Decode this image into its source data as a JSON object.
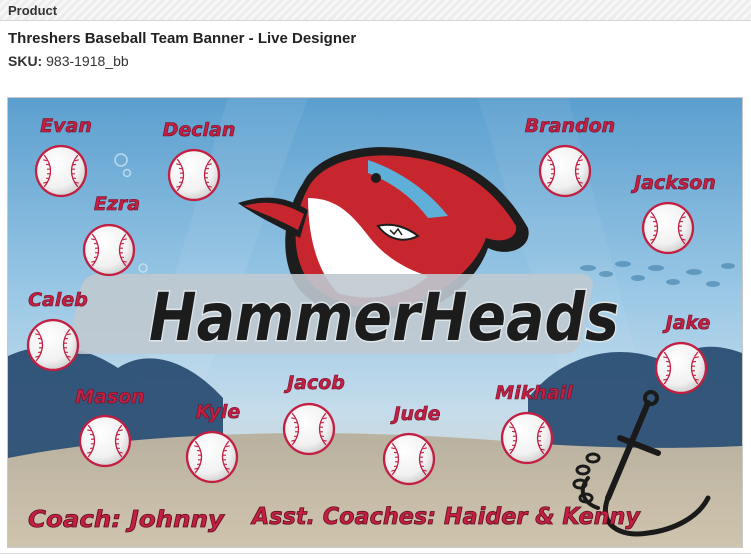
{
  "panel": {
    "header": "Product"
  },
  "product": {
    "title": "Threshers Baseball Team Banner - Live Designer",
    "sku_label": "SKU:",
    "sku_value": "983-1918_bb"
  },
  "banner": {
    "team_name": "HammerHeads",
    "players": [
      "Evan",
      "Declan",
      "Ezra",
      "Caleb",
      "Mason",
      "Kyle",
      "Jacob",
      "Jude",
      "Mikhail",
      "Brandon",
      "Jackson",
      "Jake"
    ],
    "coach_text": "Coach: Johnny",
    "asst_coaches_text": "Asst. Coaches: Haider & Kenny",
    "colors": {
      "name_red": "#c21f43",
      "water_top": "#5b9fcf",
      "sand": "#cbbfa8",
      "logo_red": "#c8262f"
    }
  }
}
